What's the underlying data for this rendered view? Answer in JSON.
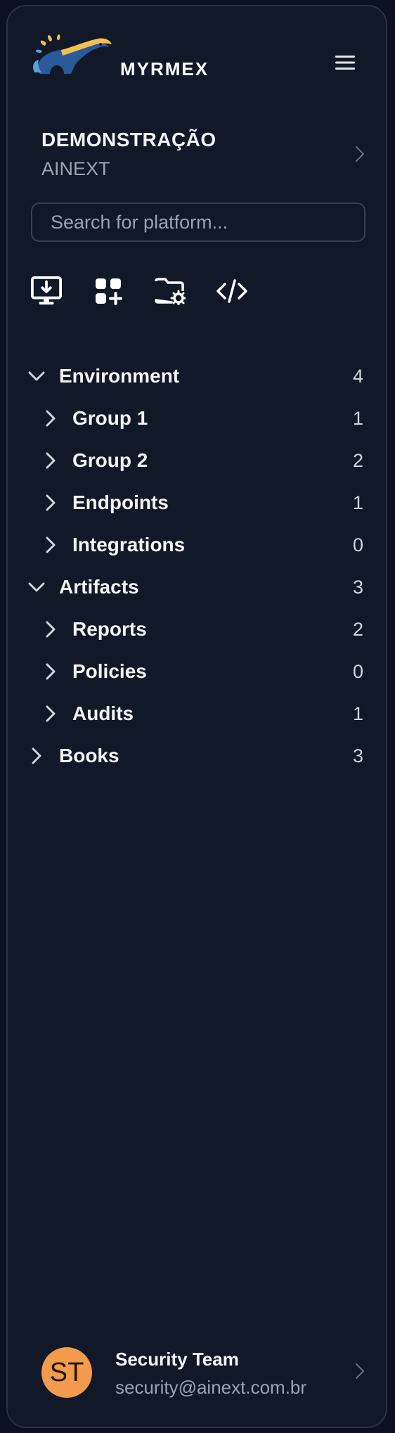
{
  "brand": {
    "name": "MYRMEX",
    "logo_icon": "anteater-logo"
  },
  "header": {
    "menu_icon": "hamburger-menu-icon"
  },
  "org": {
    "name": "DEMONSTRAÇÃO",
    "subtitle": "AINEXT"
  },
  "search": {
    "placeholder": "Search for platform..."
  },
  "toolbar": {
    "icons": [
      "monitor-download-icon",
      "apps-add-icon",
      "folder-settings-icon",
      "code-icon"
    ]
  },
  "tree": [
    {
      "label": "Environment",
      "count": "4",
      "level": 0,
      "expanded": true
    },
    {
      "label": "Group 1",
      "count": "1",
      "level": 1,
      "expanded": false
    },
    {
      "label": "Group 2",
      "count": "2",
      "level": 1,
      "expanded": false
    },
    {
      "label": "Endpoints",
      "count": "1",
      "level": 1,
      "expanded": false
    },
    {
      "label": "Integrations",
      "count": "0",
      "level": 1,
      "expanded": false
    },
    {
      "label": "Artifacts",
      "count": "3",
      "level": 0,
      "expanded": true
    },
    {
      "label": "Reports",
      "count": "2",
      "level": 1,
      "expanded": false
    },
    {
      "label": "Policies",
      "count": "0",
      "level": 1,
      "expanded": false
    },
    {
      "label": "Audits",
      "count": "1",
      "level": 1,
      "expanded": false
    },
    {
      "label": "Books",
      "count": "3",
      "level": 0,
      "expanded": false
    }
  ],
  "user": {
    "initials": "ST",
    "name": "Security Team",
    "email": "security@ainext.com.br"
  },
  "colors": {
    "background": "#111827",
    "avatar": "#f29b4f",
    "logo_gold": "#f0c050",
    "logo_blue": "#2a5a9a"
  }
}
